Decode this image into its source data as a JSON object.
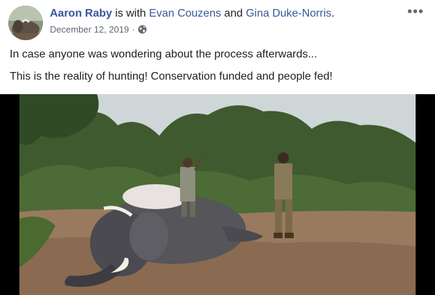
{
  "post": {
    "author": "Aaron Raby",
    "with_text": "is with",
    "tagged": [
      "Evan Couzens",
      "Gina Duke-Norris"
    ],
    "and_text": "and",
    "period": ".",
    "date": "December 12, 2019",
    "separator": "·",
    "privacy_icon": "globe-icon",
    "more_icon": "more-options-icon",
    "more_label": "•••",
    "text_lines": [
      "In case anyone was wondering about the process afterwards...",
      "This is the reality of hunting! Conservation funded and people fed!"
    ]
  },
  "media": {
    "type": "video-frame",
    "icon": "photo-image"
  },
  "colors": {
    "link": "#385898",
    "text": "#1c1e21",
    "secondary": "#606770",
    "media_bg": "#000000"
  }
}
